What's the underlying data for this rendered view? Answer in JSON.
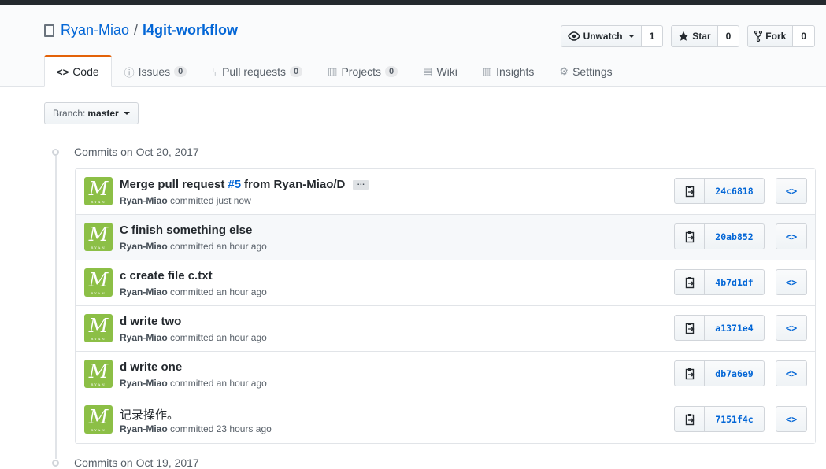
{
  "repo": {
    "owner": "Ryan-Miao",
    "separator": "/",
    "name": "l4git-workflow"
  },
  "actions": [
    {
      "label": "Unwatch",
      "icon": "eye-icon",
      "count": "1",
      "caret": true
    },
    {
      "label": "Star",
      "icon": "star-icon",
      "count": "0"
    },
    {
      "label": "Fork",
      "icon": "fork-icon",
      "count": "0"
    }
  ],
  "tabs": [
    {
      "label": "Code",
      "icon": "<>",
      "selected": true
    },
    {
      "label": "Issues",
      "icon": "ⓘ",
      "counter": "0"
    },
    {
      "label": "Pull requests",
      "icon": "⑂",
      "counter": "0"
    },
    {
      "label": "Projects",
      "icon": "▥",
      "counter": "0"
    },
    {
      "label": "Wiki",
      "icon": "▤"
    },
    {
      "label": "Insights",
      "icon": "▥"
    },
    {
      "label": "Settings",
      "icon": "⚙"
    }
  ],
  "branch": {
    "prefix": "Branch:",
    "name": "master"
  },
  "groups": [
    {
      "title": "Commits on Oct 20, 2017"
    },
    {
      "title": "Commits on Oct 19, 2017"
    }
  ],
  "commits": [
    {
      "message_pre": "Merge pull request ",
      "message_link": "#5",
      "message_post": " from Ryan-Miao/D",
      "ellipsis": "…",
      "author": "Ryan-Miao",
      "verb": "committed",
      "time": "just now",
      "sha": "24c6818"
    },
    {
      "message_pre": "C finish something else",
      "author": "Ryan-Miao",
      "verb": "committed",
      "time": "an hour ago",
      "sha": "20ab852"
    },
    {
      "message_pre": "c create file c.txt",
      "author": "Ryan-Miao",
      "verb": "committed",
      "time": "an hour ago",
      "sha": "4b7d1df"
    },
    {
      "message_pre": "d write two",
      "author": "Ryan-Miao",
      "verb": "committed",
      "time": "an hour ago",
      "sha": "a1371e4"
    },
    {
      "message_pre": "d write one",
      "author": "Ryan-Miao",
      "verb": "committed",
      "time": "an hour ago",
      "sha": "db7a6e9"
    },
    {
      "message_pre": "记录操作。",
      "author": "Ryan-Miao",
      "verb": "committed",
      "time": "23 hours ago",
      "sha": "7151f4c"
    }
  ],
  "avatar": {
    "letter": "M",
    "caption": "RYAN",
    "color": "#8cbf46"
  },
  "browse_label": "<>",
  "colors": {
    "link": "#0366d6",
    "accent": "#e36209"
  }
}
